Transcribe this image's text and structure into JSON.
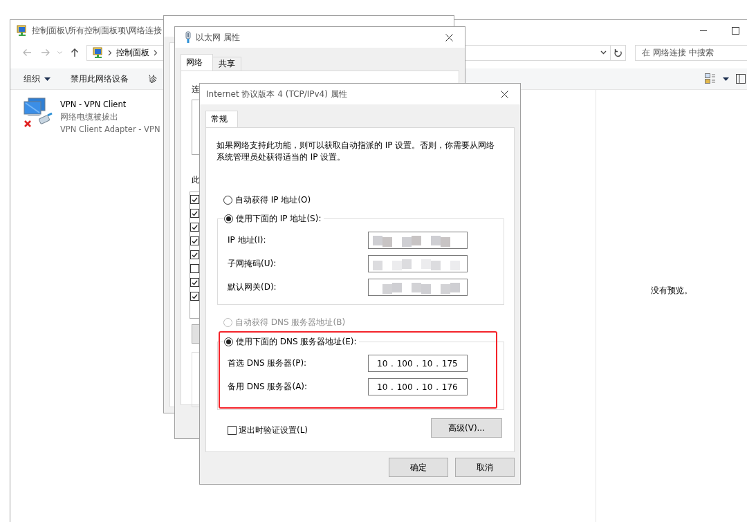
{
  "explorer": {
    "title": "控制面板\\所有控制面板项\\网络连接",
    "breadcrumb": [
      "控制面板"
    ],
    "search_placeholder": "在 网络连接 中搜索",
    "toolbar": [
      {
        "label": "组织",
        "dropdown": true
      },
      {
        "label": "禁用此网络设备",
        "dropdown": false
      },
      {
        "label": "诊",
        "dropdown": false
      }
    ],
    "connections": [
      {
        "name": "VPN - VPN Client",
        "status": "网络电缆被拔出",
        "adapter": "VPN Client Adapter - VPN",
        "disconnected": true
      }
    ],
    "preview_message": "没有预览。"
  },
  "status_window": {
    "shown": true
  },
  "properties_window": {
    "title": "以太网 属性",
    "tabs": [
      {
        "label": "网络",
        "selected": true
      },
      {
        "label": "共享",
        "selected": false
      }
    ],
    "connect_label": "连",
    "items_label": "此",
    "components": [
      {
        "checked": true
      },
      {
        "checked": true
      },
      {
        "checked": true
      },
      {
        "checked": true
      },
      {
        "checked": true
      },
      {
        "checked": false
      },
      {
        "checked": true
      },
      {
        "checked": true
      }
    ]
  },
  "ipv4_dialog": {
    "title": "Internet 协议版本 4 (TCP/IPv4) 属性",
    "tabs": [
      {
        "label": "常规",
        "selected": true
      }
    ],
    "description": "如果网络支持此功能，则可以获取自动指派的 IP 设置。否则，你需要从网络系统管理员处获得适当的 IP 设置。",
    "ip_options": [
      {
        "label": "自动获得 IP 地址(O)",
        "selected": false,
        "disabled": false
      },
      {
        "label": "使用下面的 IP 地址(S):",
        "selected": true,
        "disabled": false
      }
    ],
    "ip_fields": [
      {
        "label": "IP 地址(I):",
        "redacted": true
      },
      {
        "label": "子网掩码(U):",
        "redacted": true
      },
      {
        "label": "默认网关(D):",
        "redacted": true
      }
    ],
    "dns_options": [
      {
        "label": "自动获得 DNS 服务器地址(B)",
        "selected": false,
        "disabled": true
      },
      {
        "label": "使用下面的 DNS 服务器地址(E):",
        "selected": true,
        "disabled": false
      }
    ],
    "dns_fields": [
      {
        "label": "首选 DNS 服务器(P):",
        "value": "10 . 100 . 10 . 175"
      },
      {
        "label": "备用 DNS 服务器(A):",
        "value": "10 . 100 . 10 . 176"
      }
    ],
    "dns_highlighted": true,
    "validate_on_exit": {
      "label": "退出时验证设置(L)",
      "checked": false
    },
    "advanced_button": "高级(V)...",
    "buttons": [
      "确定",
      "取消"
    ]
  }
}
